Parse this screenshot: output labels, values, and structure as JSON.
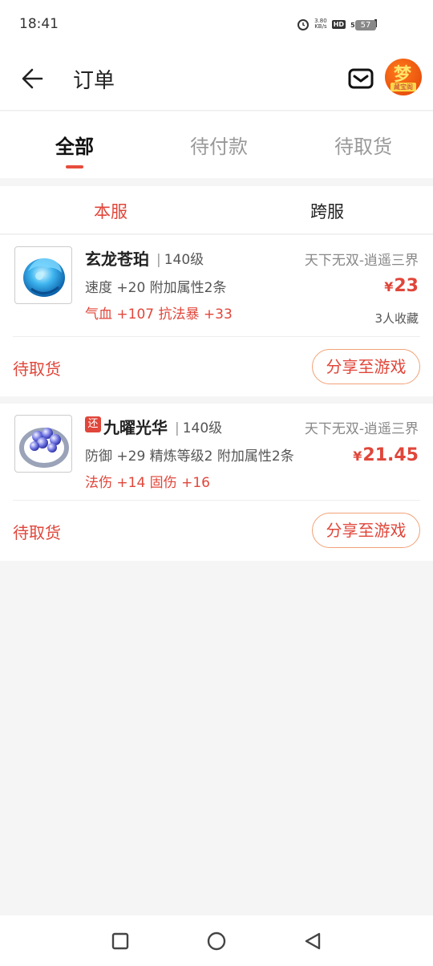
{
  "status_bar": {
    "time": "18:41",
    "net_speed_value": "3.80",
    "net_speed_unit": "KB/s",
    "hd": "HD",
    "signal": "5G",
    "battery": "57"
  },
  "header": {
    "title": "订单",
    "avatar_glyph": "梦",
    "avatar_tag": "藏宝阁"
  },
  "tabs": [
    {
      "label": "全部",
      "active": true
    },
    {
      "label": "待付款",
      "active": false
    },
    {
      "label": "待取货",
      "active": false
    }
  ],
  "server_tabs": [
    {
      "label": "本服",
      "active": true
    },
    {
      "label": "跨服",
      "active": false
    }
  ],
  "orders": [
    {
      "name": "玄龙苍珀",
      "level": "140级",
      "server": "天下无双-逍遥三界",
      "attr_line": "速度 +20 附加属性2条",
      "attr_red": "气血 +107 抗法暴 +33",
      "price_symbol": "¥",
      "price": "23",
      "favorites": "3人收藏",
      "status": "待取货",
      "share_label": "分享至游戏",
      "icon": "blue-jade-amulet-icon"
    },
    {
      "badge": "还",
      "name": "九曜光华",
      "level": "140级",
      "server": "天下无双-逍遥三界",
      "attr_line": "防御 +29 精炼等级2 附加属性2条",
      "attr_red": "法伤 +14 固伤 +16",
      "price_symbol": "¥",
      "price": "21.45",
      "status": "待取货",
      "share_label": "分享至游戏",
      "icon": "pearl-ring-icon"
    }
  ],
  "colors": {
    "accent": "#e0463a",
    "background": "#f5f5f5"
  }
}
